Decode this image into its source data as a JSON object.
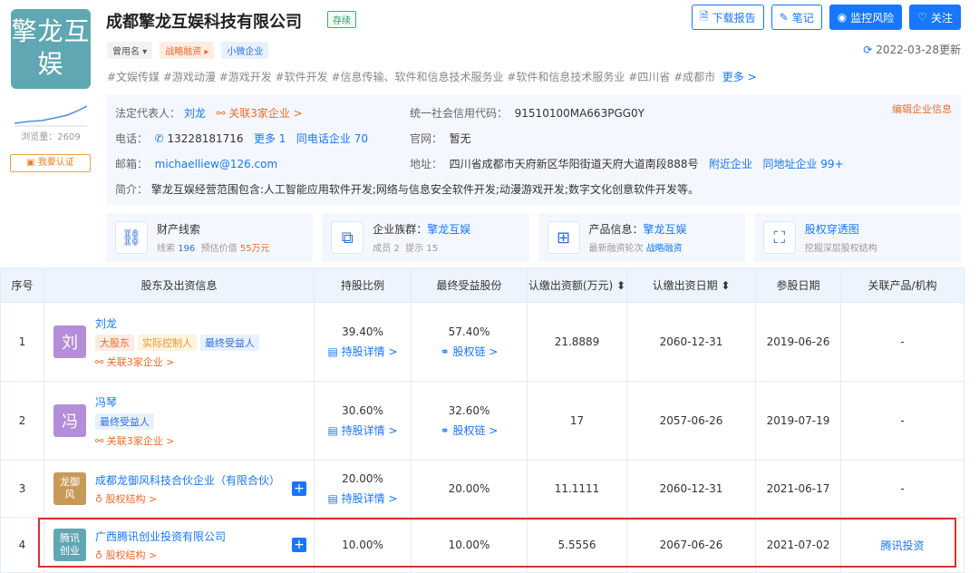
{
  "company": {
    "logo_text": "擎龙互娱",
    "name": "成都擎龙互娱科技有限公司",
    "status": "存续",
    "tags": [
      "曾用名 ▾",
      "战略融资 ▸",
      "小微企业"
    ],
    "industry_tags": "#文娱传媒  #游戏动漫  #游戏开发  #软件开发  #信息传输、软件和信息技术服务业  #软件和信息技术服务业  #四川省  #成都市",
    "industry_more": "更多 >",
    "views": "浏览量：2609",
    "claim": "我要认证"
  },
  "toolbar": {
    "download": "下载报告",
    "note": "笔记",
    "monitor": "监控风险",
    "follow": "关注"
  },
  "update": {
    "icon": "refresh-icon",
    "date": "2022-03-28更新"
  },
  "info": {
    "legal_rep_label": "法定代表人：",
    "legal_rep": "刘龙",
    "legal_rep_rel": "关联3家企业 >",
    "credit_label": "统一社会信用代码：",
    "credit_code": "91510100MA663PGG0Y",
    "phone_label": "电话：",
    "phone": "13228181716",
    "phone_more": "更多 1",
    "phone_same": "同电话企业 70",
    "site_label": "官网：",
    "site": "暂无",
    "email_label": "邮箱：",
    "email": "michaelliew@126.com",
    "addr_label": "地址：",
    "addr": "四川省成都市天府新区华阳街道天府大道南段888号",
    "addr_near": "附近企业",
    "addr_same": "同地址企业 99+",
    "intro_label": "简介：",
    "intro": "擎龙互娱经营范围包含:人工智能应用软件开发;网络与信息安全软件开发;动漫游戏开发;数字文化创意软件开发等。",
    "edit": "编辑企业信息"
  },
  "cards": [
    {
      "title": "财产线索",
      "sub1": "线索",
      "sub1v": "196",
      "sub2": "预估价值",
      "sub2v": "55万元"
    },
    {
      "title": "企业族群：",
      "titlev": "擎龙互娱",
      "sub1": "成员 2",
      "sub2": "提示 15"
    },
    {
      "title": "产品信息：",
      "titlev": "擎龙互娱",
      "sub1": "最新融资轮次",
      "sub2": "战略融资"
    },
    {
      "title": "股权穿透图",
      "sub1": "挖掘深层股权结构"
    }
  ],
  "table": {
    "headers": [
      "序号",
      "股东及出资信息",
      "持股比例",
      "最终受益股份",
      "认缴出资额(万元) ⬍",
      "认缴出资日期 ⬍",
      "参股日期",
      "关联产品/机构"
    ],
    "rows": [
      {
        "no": "1",
        "avatar": "刘",
        "avatar_color": "#b48ed9",
        "name": "刘龙",
        "tags": [
          "大股东",
          "实际控制人",
          "最终受益人"
        ],
        "sub": "关联3家企业 >",
        "ratio": "39.40%",
        "ratio_link": "持股详情 >",
        "benefit": "57.40%",
        "benefit_link": "股权链 >",
        "amount": "21.8889",
        "date": "2060-12-31",
        "join": "2019-06-26",
        "product": "-"
      },
      {
        "no": "2",
        "avatar": "冯",
        "avatar_color": "#b48ed9",
        "name": "冯琴",
        "tags": [
          "最终受益人"
        ],
        "sub": "关联3家企业 >",
        "ratio": "30.60%",
        "ratio_link": "持股详情 >",
        "benefit": "32.60%",
        "benefit_link": "股权链 >",
        "amount": "17",
        "date": "2057-06-26",
        "join": "2019-07-19",
        "product": "-"
      },
      {
        "no": "3",
        "avatar": "龙御风",
        "avatar_color": "#c89a5a",
        "name": "成都龙御风科技合伙企业（有限合伙）",
        "tags": [],
        "sub": "股权结构 >",
        "ratio": "20.00%",
        "ratio_link": "持股详情 >",
        "benefit": "20.00%",
        "benefit_link": "",
        "amount": "11.1111",
        "date": "2060-12-31",
        "join": "2021-06-17",
        "product": "-"
      },
      {
        "no": "4",
        "avatar": "腾讯创业",
        "avatar_color": "#5fa7b2",
        "name": "广西腾讯创业投资有限公司",
        "tags": [],
        "sub": "股权结构 >",
        "ratio": "10.00%",
        "ratio_link": "",
        "benefit": "10.00%",
        "benefit_link": "",
        "amount": "5.5556",
        "date": "2067-06-26",
        "join": "2021-07-02",
        "product": "腾讯投资"
      }
    ]
  }
}
